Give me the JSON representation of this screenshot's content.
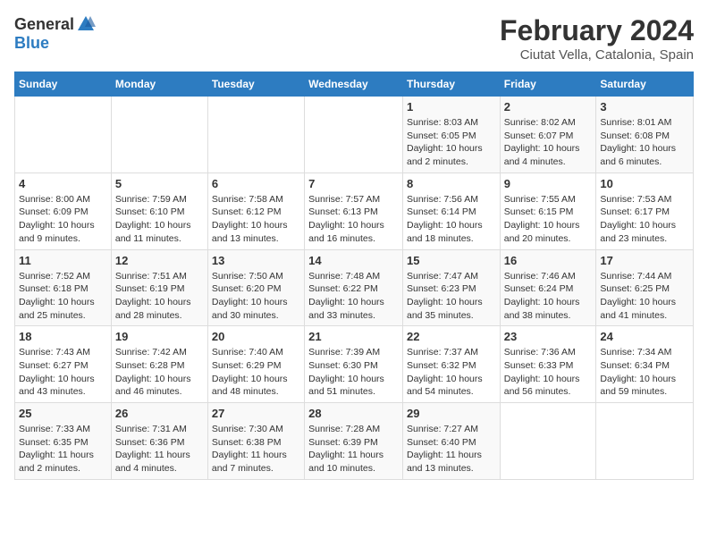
{
  "header": {
    "logo_general": "General",
    "logo_blue": "Blue",
    "main_title": "February 2024",
    "sub_title": "Ciutat Vella, Catalonia, Spain"
  },
  "calendar": {
    "weekdays": [
      "Sunday",
      "Monday",
      "Tuesday",
      "Wednesday",
      "Thursday",
      "Friday",
      "Saturday"
    ],
    "rows": [
      [
        {
          "day": "",
          "info": ""
        },
        {
          "day": "",
          "info": ""
        },
        {
          "day": "",
          "info": ""
        },
        {
          "day": "",
          "info": ""
        },
        {
          "day": "1",
          "info": "Sunrise: 8:03 AM\nSunset: 6:05 PM\nDaylight: 10 hours\nand 2 minutes."
        },
        {
          "day": "2",
          "info": "Sunrise: 8:02 AM\nSunset: 6:07 PM\nDaylight: 10 hours\nand 4 minutes."
        },
        {
          "day": "3",
          "info": "Sunrise: 8:01 AM\nSunset: 6:08 PM\nDaylight: 10 hours\nand 6 minutes."
        }
      ],
      [
        {
          "day": "4",
          "info": "Sunrise: 8:00 AM\nSunset: 6:09 PM\nDaylight: 10 hours\nand 9 minutes."
        },
        {
          "day": "5",
          "info": "Sunrise: 7:59 AM\nSunset: 6:10 PM\nDaylight: 10 hours\nand 11 minutes."
        },
        {
          "day": "6",
          "info": "Sunrise: 7:58 AM\nSunset: 6:12 PM\nDaylight: 10 hours\nand 13 minutes."
        },
        {
          "day": "7",
          "info": "Sunrise: 7:57 AM\nSunset: 6:13 PM\nDaylight: 10 hours\nand 16 minutes."
        },
        {
          "day": "8",
          "info": "Sunrise: 7:56 AM\nSunset: 6:14 PM\nDaylight: 10 hours\nand 18 minutes."
        },
        {
          "day": "9",
          "info": "Sunrise: 7:55 AM\nSunset: 6:15 PM\nDaylight: 10 hours\nand 20 minutes."
        },
        {
          "day": "10",
          "info": "Sunrise: 7:53 AM\nSunset: 6:17 PM\nDaylight: 10 hours\nand 23 minutes."
        }
      ],
      [
        {
          "day": "11",
          "info": "Sunrise: 7:52 AM\nSunset: 6:18 PM\nDaylight: 10 hours\nand 25 minutes."
        },
        {
          "day": "12",
          "info": "Sunrise: 7:51 AM\nSunset: 6:19 PM\nDaylight: 10 hours\nand 28 minutes."
        },
        {
          "day": "13",
          "info": "Sunrise: 7:50 AM\nSunset: 6:20 PM\nDaylight: 10 hours\nand 30 minutes."
        },
        {
          "day": "14",
          "info": "Sunrise: 7:48 AM\nSunset: 6:22 PM\nDaylight: 10 hours\nand 33 minutes."
        },
        {
          "day": "15",
          "info": "Sunrise: 7:47 AM\nSunset: 6:23 PM\nDaylight: 10 hours\nand 35 minutes."
        },
        {
          "day": "16",
          "info": "Sunrise: 7:46 AM\nSunset: 6:24 PM\nDaylight: 10 hours\nand 38 minutes."
        },
        {
          "day": "17",
          "info": "Sunrise: 7:44 AM\nSunset: 6:25 PM\nDaylight: 10 hours\nand 41 minutes."
        }
      ],
      [
        {
          "day": "18",
          "info": "Sunrise: 7:43 AM\nSunset: 6:27 PM\nDaylight: 10 hours\nand 43 minutes."
        },
        {
          "day": "19",
          "info": "Sunrise: 7:42 AM\nSunset: 6:28 PM\nDaylight: 10 hours\nand 46 minutes."
        },
        {
          "day": "20",
          "info": "Sunrise: 7:40 AM\nSunset: 6:29 PM\nDaylight: 10 hours\nand 48 minutes."
        },
        {
          "day": "21",
          "info": "Sunrise: 7:39 AM\nSunset: 6:30 PM\nDaylight: 10 hours\nand 51 minutes."
        },
        {
          "day": "22",
          "info": "Sunrise: 7:37 AM\nSunset: 6:32 PM\nDaylight: 10 hours\nand 54 minutes."
        },
        {
          "day": "23",
          "info": "Sunrise: 7:36 AM\nSunset: 6:33 PM\nDaylight: 10 hours\nand 56 minutes."
        },
        {
          "day": "24",
          "info": "Sunrise: 7:34 AM\nSunset: 6:34 PM\nDaylight: 10 hours\nand 59 minutes."
        }
      ],
      [
        {
          "day": "25",
          "info": "Sunrise: 7:33 AM\nSunset: 6:35 PM\nDaylight: 11 hours\nand 2 minutes."
        },
        {
          "day": "26",
          "info": "Sunrise: 7:31 AM\nSunset: 6:36 PM\nDaylight: 11 hours\nand 4 minutes."
        },
        {
          "day": "27",
          "info": "Sunrise: 7:30 AM\nSunset: 6:38 PM\nDaylight: 11 hours\nand 7 minutes."
        },
        {
          "day": "28",
          "info": "Sunrise: 7:28 AM\nSunset: 6:39 PM\nDaylight: 11 hours\nand 10 minutes."
        },
        {
          "day": "29",
          "info": "Sunrise: 7:27 AM\nSunset: 6:40 PM\nDaylight: 11 hours\nand 13 minutes."
        },
        {
          "day": "",
          "info": ""
        },
        {
          "day": "",
          "info": ""
        }
      ]
    ]
  }
}
